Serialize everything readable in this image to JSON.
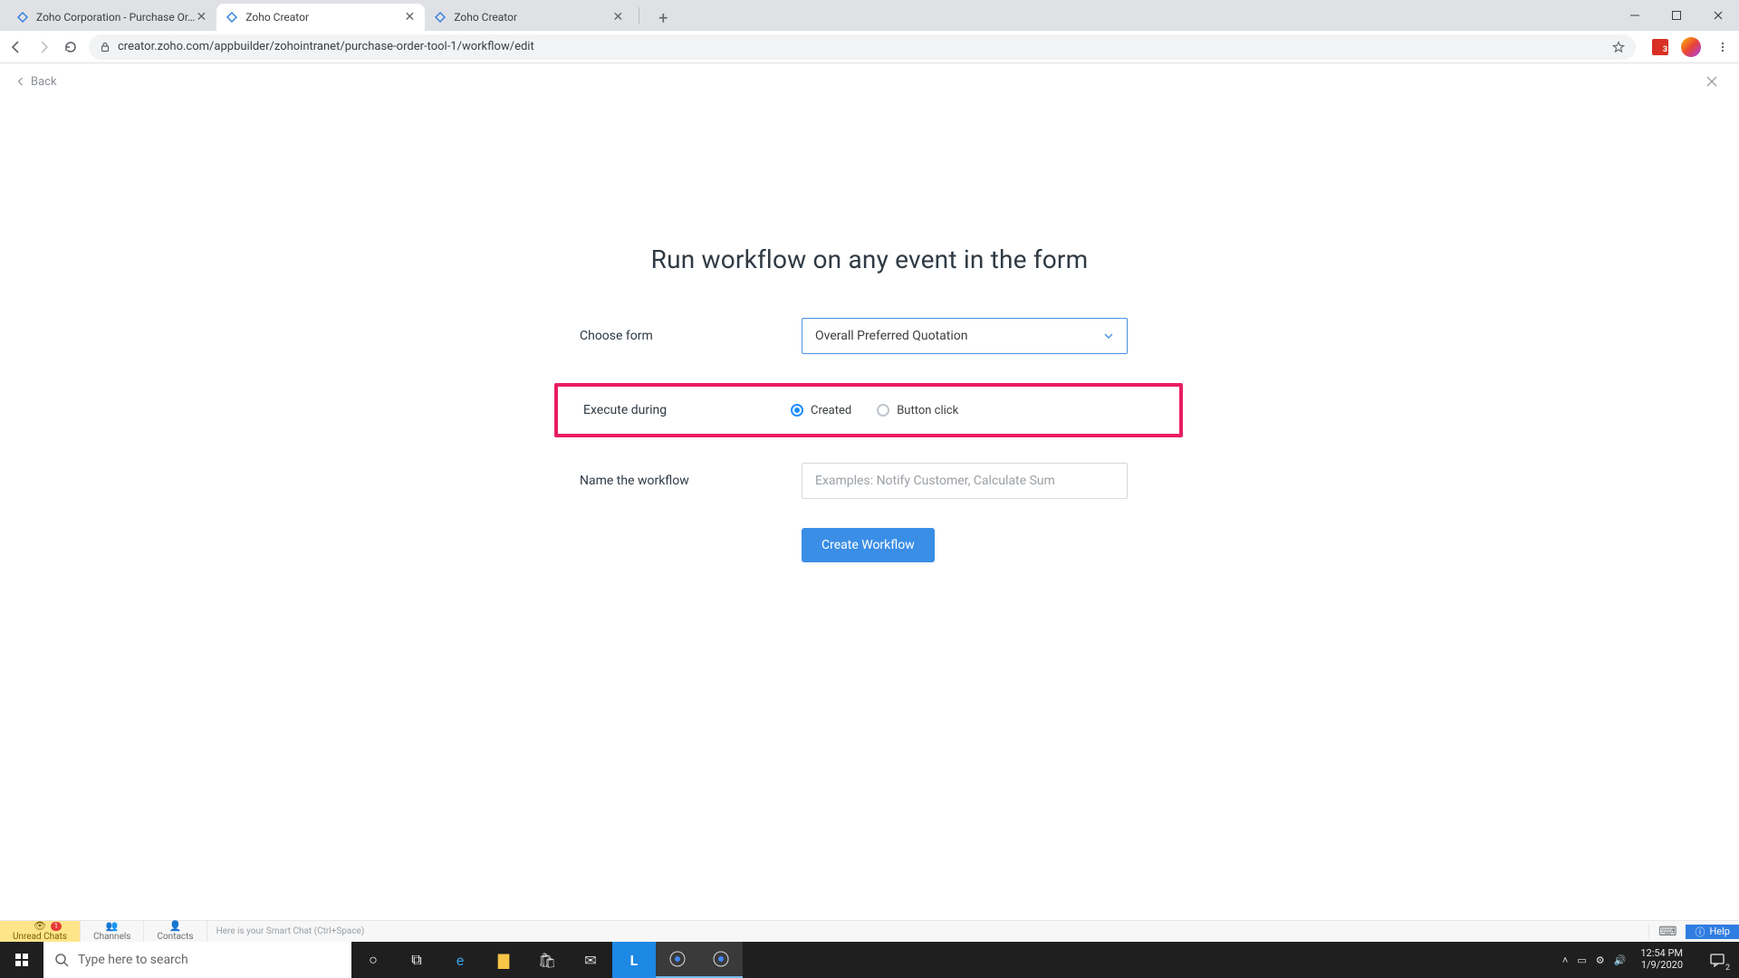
{
  "browser": {
    "tabs": [
      {
        "title": "Zoho Corporation - Purchase Or…"
      },
      {
        "title": "Zoho Creator"
      },
      {
        "title": "Zoho Creator"
      }
    ],
    "active_tab_index": 1,
    "url": "creator.zoho.com/appbuilder/zohointranet/purchase-order-tool-1/workflow/edit",
    "extension_badge": "3"
  },
  "app": {
    "back_label": "Back",
    "title": "Run workflow on any event in the form",
    "form": {
      "choose_form_label": "Choose form",
      "choose_form_value": "Overall Preferred Quotation",
      "execute_label": "Execute during",
      "execute_options": {
        "created": "Created",
        "button_click": "Button click"
      },
      "execute_selected": "created",
      "name_label": "Name the workflow",
      "name_placeholder": "Examples: Notify Customer, Calculate Sum",
      "name_value": "",
      "submit_label": "Create Workflow"
    }
  },
  "chatbar": {
    "unread_label": "Unread Chats",
    "unread_count": "1",
    "channels_label": "Channels",
    "contacts_label": "Contacts",
    "smartchat_placeholder": "Here is your Smart Chat (Ctrl+Space)",
    "help_label": "Help"
  },
  "taskbar": {
    "search_placeholder": "Type here to search",
    "time": "12:54 PM",
    "date": "1/9/2020",
    "notif_count": "2"
  }
}
